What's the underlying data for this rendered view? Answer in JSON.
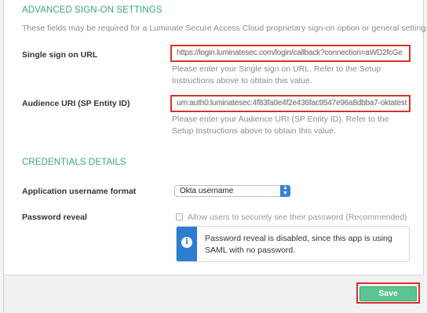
{
  "advanced": {
    "title": "ADVANCED SIGN-ON SETTINGS",
    "description": "These fields may be required for a Luminate Secure Access Cloud proprietary sign-on option or general setting."
  },
  "sso_url": {
    "label": "Single sign on URL",
    "value": "https://login.luminatesec.com/login/callback?connection=aWD2fcGe",
    "help": "Please enter your Single sign on URL. Refer to the Setup Instructions above to obtain this value."
  },
  "audience_uri": {
    "label": "Audience URI (SP Entity ID)",
    "value": "urn:auth0:luminatesec:4f83fa0e4f2e436fac9547e96a8dbba7-oktatest",
    "help": "Please enter your Audience URI (SP Entity ID). Refer to the Setup Instructions above to obtain this value."
  },
  "credentials": {
    "title": "CREDENTIALS DETAILS",
    "username_format": {
      "label": "Application username format",
      "selected": "Okta username"
    },
    "password_reveal": {
      "label": "Password reveal",
      "checkbox_label": "Allow users to securely see their password (Recommended)",
      "checked": false,
      "info_message": "Password reveal is disabled, since this app is using SAML with no password.",
      "info_icon": "info-icon"
    }
  },
  "footer": {
    "save_label": "Save"
  },
  "colors": {
    "accent": "#3aa387",
    "highlight_border": "#d6342b",
    "save_button": "#5cc493",
    "info_bar": "#2b7ed1"
  }
}
